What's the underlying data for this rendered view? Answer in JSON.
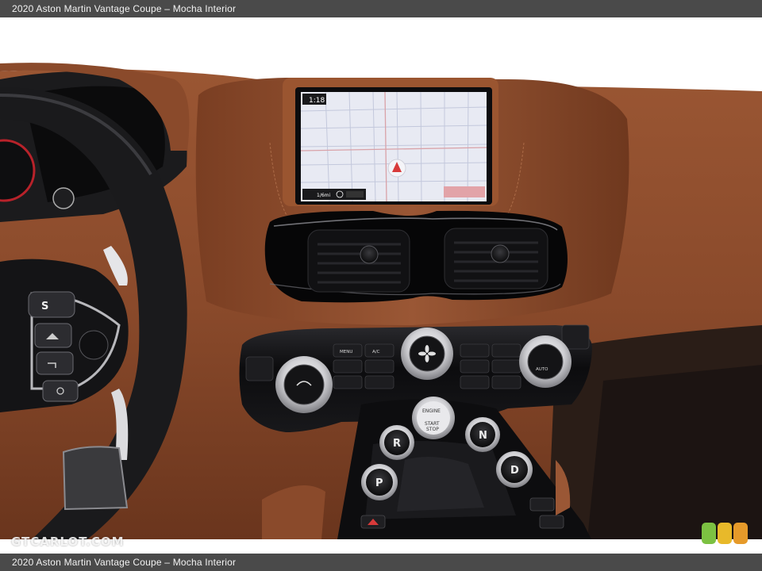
{
  "caption_top": "2020 Aston Martin Vantage Coupe – Mocha Interior",
  "caption_bottom": "2020 Aston Martin Vantage Coupe – Mocha Interior",
  "watermark": "GTCARLOT.COM",
  "screen": {
    "time": "1:18",
    "scale": "1/6mi"
  },
  "buttons": {
    "s": "S",
    "r": "R",
    "n": "N",
    "p": "P",
    "d": "D",
    "auto": "AUTO",
    "menu": "MENU",
    "ac": "A/C",
    "start_stop_top": "ENGINE",
    "start_stop_mid": "START",
    "start_stop_bottom": "STOP"
  },
  "colors": {
    "leather": "#8a4a2b",
    "leather_dark": "#5e2f19",
    "piano_black": "#0d0d0f",
    "chrome": "#c9c9cc",
    "map_bg": "#e8eaf3",
    "dot_green": "#7cc142",
    "dot_yellow": "#e8b92a",
    "dot_orange": "#e69a2a"
  }
}
